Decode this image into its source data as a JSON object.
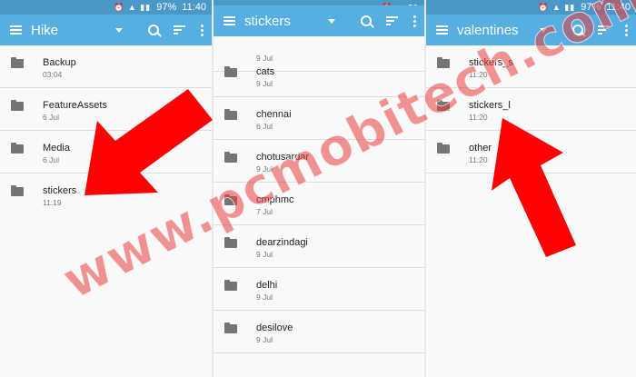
{
  "status": {
    "battery": "97%",
    "time": "11:40"
  },
  "panels": [
    {
      "title": "Hike",
      "items": [
        {
          "name": "Backup",
          "date": "03:04"
        },
        {
          "name": "FeatureAssets",
          "date": "6 Jul"
        },
        {
          "name": "Media",
          "date": "6 Jul"
        },
        {
          "name": "stickers",
          "date": "11:19"
        }
      ]
    },
    {
      "title": "stickers",
      "items": [
        {
          "name": "",
          "date": "9 Jul"
        },
        {
          "name": "cats",
          "date": "9 Jul"
        },
        {
          "name": "chennai",
          "date": "6 Jul"
        },
        {
          "name": "chotusardar",
          "date": "9 Jul"
        },
        {
          "name": "cmphmc",
          "date": "7 Jul"
        },
        {
          "name": "dearzindagi",
          "date": "9 Jul"
        },
        {
          "name": "delhi",
          "date": "9 Jul"
        },
        {
          "name": "desilove",
          "date": "9 Jul"
        }
      ]
    },
    {
      "title": "valentines",
      "items": [
        {
          "name": "stickers_s",
          "date": "11:20"
        },
        {
          "name": "stickers_l",
          "date": "11:20"
        },
        {
          "name": "other",
          "date": "11:20"
        }
      ]
    }
  ],
  "watermark": "www.pcmobitech.com",
  "colors": {
    "appbar": "#56aee2",
    "statusbar": "#4a98c8",
    "arrow": "#ff0000"
  },
  "icons": {
    "menu": "hamburger-icon",
    "dropdown": "dropdown-icon",
    "search": "search-icon",
    "sort": "sort-icon",
    "more": "more-vert-icon",
    "folder": "folder-icon"
  }
}
